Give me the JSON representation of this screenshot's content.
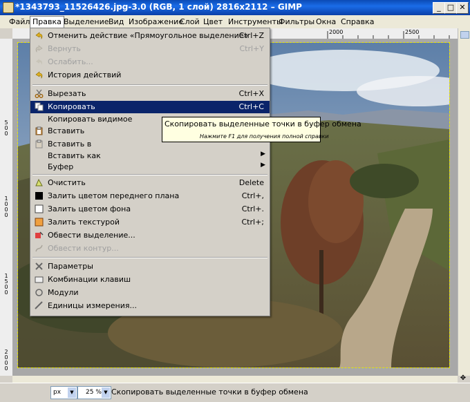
{
  "window": {
    "title": "*1343793_11526426.jpg-3.0 (RGB, 1 слой) 2816x2112 – GIMP",
    "minimize": "_",
    "maximize": "□",
    "close": "✕"
  },
  "menubar": [
    "Файл",
    "Правка",
    "Выделение",
    "Вид",
    "Изображение",
    "Слой",
    "Цвет",
    "Инструменты",
    "Фильтры",
    "Окна",
    "Справка"
  ],
  "ruler": {
    "h_labels": [
      "2000",
      "2500"
    ],
    "v_labels": [
      "500",
      "1000",
      "1500",
      "2000"
    ]
  },
  "edit_menu": {
    "items": [
      {
        "label": "Отменить действие «Прямоугольное выделение»",
        "shortcut": "Ctrl+Z",
        "icon": "undo-icon",
        "disabled": false
      },
      {
        "label": "Вернуть",
        "shortcut": "Ctrl+Y",
        "icon": "redo-icon",
        "disabled": true
      },
      {
        "label": "Ослабить...",
        "shortcut": "",
        "icon": "fade-icon",
        "disabled": true
      },
      {
        "label": "История действий",
        "shortcut": "",
        "icon": "history-icon",
        "disabled": false
      },
      {
        "label": "Вырезать",
        "shortcut": "Ctrl+X",
        "icon": "cut-icon",
        "disabled": false
      },
      {
        "label": "Копировать",
        "shortcut": "Ctrl+C",
        "icon": "copy-icon",
        "disabled": false,
        "highlighted": true
      },
      {
        "label": "Копировать видимое",
        "shortcut": "",
        "icon": "",
        "disabled": false
      },
      {
        "label": "Вставить",
        "shortcut": "",
        "icon": "paste-icon",
        "disabled": false
      },
      {
        "label": "Вставить в",
        "shortcut": "",
        "icon": "paste-into-icon",
        "disabled": false
      },
      {
        "label": "Вставить как",
        "shortcut": "",
        "icon": "",
        "disabled": false,
        "submenu": true
      },
      {
        "label": "Буфер",
        "shortcut": "",
        "icon": "",
        "disabled": false,
        "submenu": true
      },
      {
        "label": "Очистить",
        "shortcut": "Delete",
        "icon": "clear-icon",
        "disabled": false
      },
      {
        "label": "Залить цветом переднего плана",
        "shortcut": "Ctrl+,",
        "icon": "fill-fg-icon",
        "disabled": false
      },
      {
        "label": "Залить цветом фона",
        "shortcut": "Ctrl+.",
        "icon": "fill-bg-icon",
        "disabled": false
      },
      {
        "label": "Залить текстурой",
        "shortcut": "Ctrl+;",
        "icon": "fill-pattern-icon",
        "disabled": false
      },
      {
        "label": "Обвести выделение...",
        "shortcut": "",
        "icon": "stroke-selection-icon",
        "disabled": false
      },
      {
        "label": "Обвести контур...",
        "shortcut": "",
        "icon": "stroke-path-icon",
        "disabled": true
      },
      {
        "label": "Параметры",
        "shortcut": "",
        "icon": "preferences-icon",
        "disabled": false
      },
      {
        "label": "Комбинации клавиш",
        "shortcut": "",
        "icon": "keyboard-icon",
        "disabled": false
      },
      {
        "label": "Модули",
        "shortcut": "",
        "icon": "modules-icon",
        "disabled": false
      },
      {
        "label": "Единицы измерения...",
        "shortcut": "",
        "icon": "units-icon",
        "disabled": false
      }
    ]
  },
  "tooltip": {
    "text": "Скопировать выделенные точки в буфер обмена",
    "hint": "Нажмите F1 для получения полной справки"
  },
  "statusbar": {
    "unit": "px",
    "zoom": "25 %",
    "message": "Скопировать выделенные точки в буфер обмена"
  },
  "colors": {
    "highlight": "#0a246a",
    "menu_bg": "#d4d0c8",
    "tooltip_bg": "#ffffe1",
    "title_bg": "#1a6ce8"
  }
}
